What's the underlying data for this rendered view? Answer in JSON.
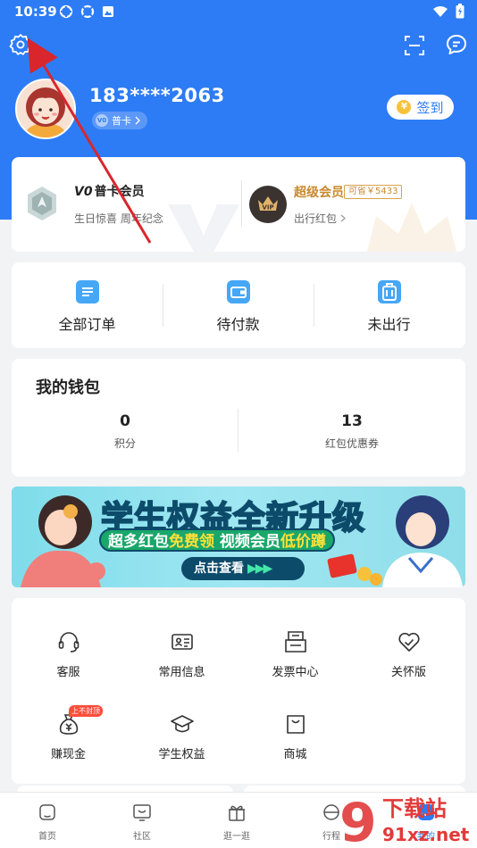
{
  "status_bar": {
    "time": "10:39"
  },
  "user": {
    "phone": "183****2063",
    "tier_label": "普卡",
    "tier_mini": "V0"
  },
  "signin": {
    "label": "签到",
    "coin_symbol": "¥"
  },
  "membership": {
    "left": {
      "title": "普卡会员",
      "title_mark": "V0",
      "subtitle": "生日惊喜  周年纪念"
    },
    "right": {
      "title": "超级会员",
      "save_tag": "可省￥5433",
      "subtitle": "出行红包",
      "badge": "VIP"
    }
  },
  "orders": [
    {
      "label": "全部订单",
      "icon": "order-list-icon"
    },
    {
      "label": "待付款",
      "icon": "wallet-icon"
    },
    {
      "label": "未出行",
      "icon": "luggage-icon"
    }
  ],
  "wallet": {
    "title": "我的钱包",
    "items": [
      {
        "value": "0",
        "label": "积分"
      },
      {
        "value": "13",
        "label": "红包优惠券"
      }
    ]
  },
  "banner": {
    "title_part1": "学生权益",
    "title_part2": "全新升级",
    "sub_part1": "超多红包",
    "sub_part2": "免费领",
    "sub_part3": " 视频会员",
    "sub_part4": "低价蹲",
    "button": "点击查看",
    "button_arrows": "▶▶▶"
  },
  "services": [
    {
      "label": "客服",
      "icon": "headset-icon"
    },
    {
      "label": "常用信息",
      "icon": "id-card-icon"
    },
    {
      "label": "发票中心",
      "icon": "invoice-icon"
    },
    {
      "label": "关怀版",
      "icon": "heart-check-icon"
    },
    {
      "label": "赚现金",
      "icon": "money-bag-icon",
      "tag": "上不封顶"
    },
    {
      "label": "学生权益",
      "icon": "graduation-cap-icon"
    },
    {
      "label": "商城",
      "icon": "shopping-bag-icon"
    }
  ],
  "bottom_nav": [
    {
      "label": "首页",
      "icon": "home-icon"
    },
    {
      "label": "社区",
      "icon": "community-icon"
    },
    {
      "label": "逛一逛",
      "icon": "gift-icon"
    },
    {
      "label": "行程",
      "icon": "trip-icon"
    },
    {
      "label": "我的",
      "icon": "profile-icon"
    }
  ],
  "watermark": {
    "text_top": "下载站",
    "text_bottom": "91xz.net"
  },
  "colors": {
    "brand_blue": "#2d7cf6",
    "annotation_red": "#d9262c",
    "gold": "#c9892e"
  }
}
